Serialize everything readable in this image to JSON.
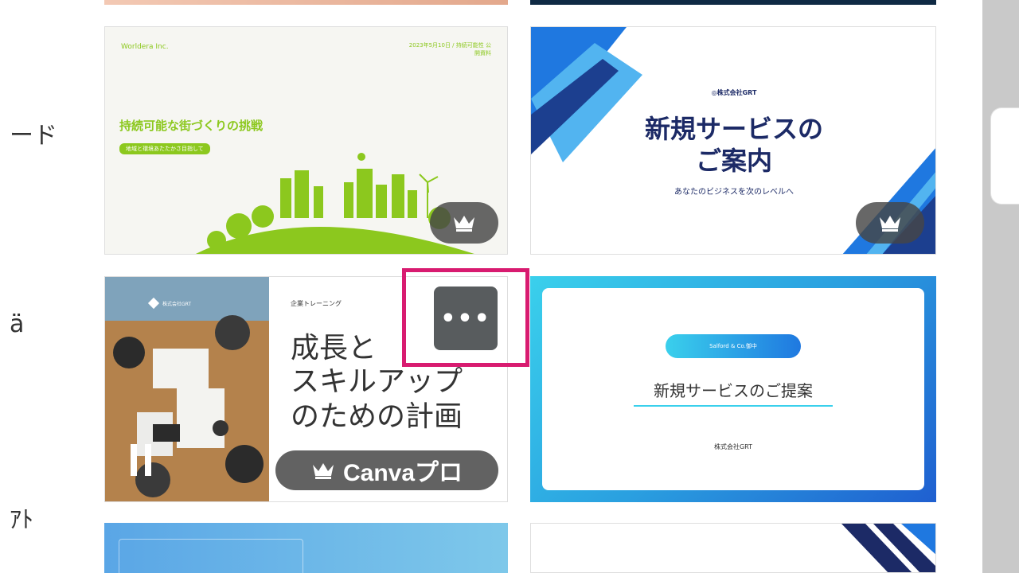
{
  "sidebar": {
    "items": [
      {
        "label": "ード"
      },
      {
        "label": "ä"
      },
      {
        "label": "ｱﾄ"
      }
    ]
  },
  "templates": [
    {
      "org": "Worldera Inc.",
      "meta": "2023年5月10日 / 持続可能性 公開資料",
      "title": "持続可能な街づくりの挑戦",
      "subtitle": "地域と環境あたたかさ目指して",
      "pro": true
    },
    {
      "org": "◎株式会社GRT",
      "title_line1": "新規サービスの",
      "title_line2": "ご案内",
      "subtitle": "あなたのビジネスを次のレベルへ",
      "pro": true
    },
    {
      "org": "株式会社GRT",
      "category": "企業トレーニング",
      "title_line1": "成長と",
      "title_line2": "スキルアップ",
      "title_line3": "のための計画",
      "badge_label": "Canvaプロ"
    },
    {
      "pill": "Salford & Co.御中",
      "title": "新規サービスのご提案",
      "company": "株式会社GRT"
    }
  ],
  "more_button": {
    "label": "•••"
  },
  "colors": {
    "accent_green": "#8cc81e",
    "navy": "#1c2a66",
    "blue": "#1f78e0",
    "cyan": "#3ad0ec",
    "highlight": "#d81b70"
  }
}
